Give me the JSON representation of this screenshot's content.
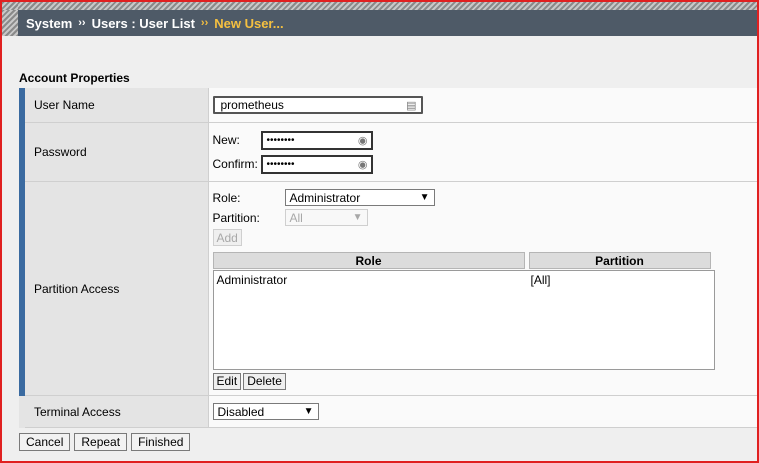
{
  "breadcrumb": {
    "items": [
      "System",
      "Users : User List",
      "New User..."
    ],
    "separator": "››"
  },
  "section": {
    "title": "Account Properties"
  },
  "user_name": {
    "label": "User Name",
    "value": "prometheus"
  },
  "password": {
    "label": "Password",
    "new_label": "New:",
    "confirm_label": "Confirm:",
    "new_value": "••••••••",
    "confirm_value": "••••••••"
  },
  "partition_access": {
    "label": "Partition Access",
    "role_label": "Role:",
    "role_value": "Administrator",
    "partition_label": "Partition:",
    "partition_value": "All",
    "add_label": "Add",
    "columns": [
      "Role",
      "Partition"
    ],
    "rows": [
      {
        "role": "Administrator",
        "partition": "[All]"
      }
    ],
    "edit_label": "Edit",
    "delete_label": "Delete"
  },
  "terminal_access": {
    "label": "Terminal Access",
    "value": "Disabled"
  },
  "footer": {
    "cancel": "Cancel",
    "repeat": "Repeat",
    "finished": "Finished"
  }
}
